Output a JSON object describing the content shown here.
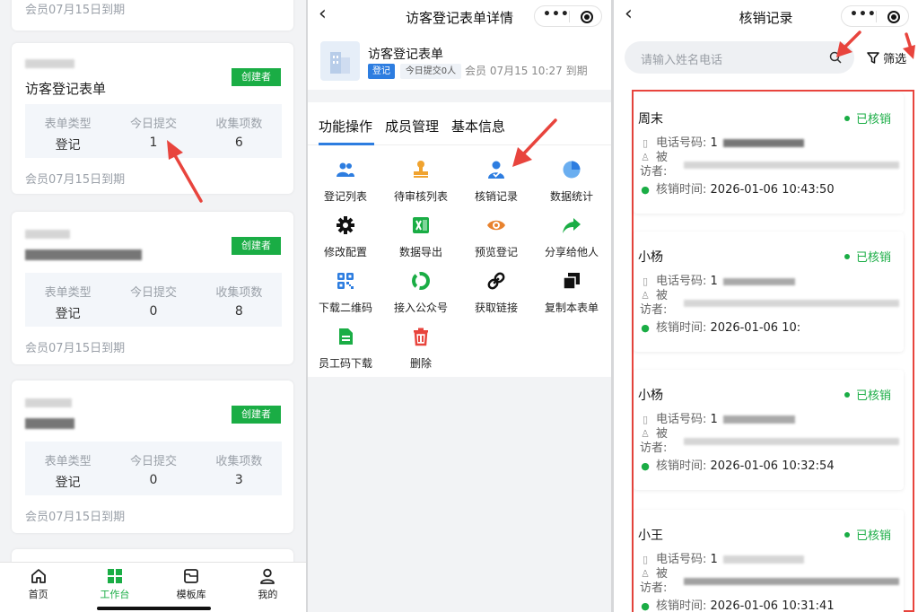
{
  "workbench": {
    "top_expire": "会员07月15日到期",
    "cards": [
      {
        "title": "访客登记表单",
        "badge": "创建者",
        "stat_labels": [
          "表单类型",
          "今日提交",
          "收集项数"
        ],
        "stat_values": [
          "登记",
          "1",
          "6"
        ],
        "expire": "会员07月15日到期"
      },
      {
        "title": "",
        "badge": "创建者",
        "stat_labels": [
          "表单类型",
          "今日提交",
          "收集项数"
        ],
        "stat_values": [
          "登记",
          "0",
          "8"
        ],
        "expire": "会员07月15日到期"
      },
      {
        "title": "",
        "badge": "创建者",
        "stat_labels": [
          "表单类型",
          "今日提交",
          "收集项数"
        ],
        "stat_values": [
          "登记",
          "0",
          "3"
        ],
        "expire": "会员07月15日到期"
      }
    ],
    "tabbar": [
      {
        "label": "首页",
        "icon": "home-icon"
      },
      {
        "label": "工作台",
        "icon": "grid-icon",
        "active": true
      },
      {
        "label": "模板库",
        "icon": "folder-icon"
      },
      {
        "label": "我的",
        "icon": "user-icon"
      }
    ]
  },
  "detail": {
    "title": "访客登记表单详情",
    "form_name": "访客登记表单",
    "tag_type": "登记",
    "tag_today": "今日提交0人",
    "member_time": "会员 07月15 10:27 到期",
    "tabs": [
      "功能操作",
      "成员管理",
      "基本信息"
    ],
    "functions": [
      {
        "label": "登记列表",
        "icon": "users-icon",
        "color": "#2d7de0"
      },
      {
        "label": "待审核列表",
        "icon": "stamp-icon",
        "color": "#f0a32f"
      },
      {
        "label": "核销记录",
        "icon": "user-check-icon",
        "color": "#2d7de0"
      },
      {
        "label": "数据统计",
        "icon": "pie-chart-icon",
        "color": "#3a8ee6"
      },
      {
        "label": "修改配置",
        "icon": "gear-icon",
        "color": "#111111"
      },
      {
        "label": "数据导出",
        "icon": "excel-icon",
        "color": "#1aad45"
      },
      {
        "label": "预览登记",
        "icon": "eye-icon",
        "color": "#e8822e"
      },
      {
        "label": "分享给他人",
        "icon": "share-icon",
        "color": "#1aad45"
      },
      {
        "label": "下载二维码",
        "icon": "qrcode-icon",
        "color": "#2d7de0"
      },
      {
        "label": "接入公众号",
        "icon": "loop-icon",
        "color": "#1aad45"
      },
      {
        "label": "获取链接",
        "icon": "link-icon",
        "color": "#111111"
      },
      {
        "label": "复制本表单",
        "icon": "copy-icon",
        "color": "#111111"
      },
      {
        "label": "员工码下载",
        "icon": "file-icon",
        "color": "#1aad45"
      },
      {
        "label": "删除",
        "icon": "trash-icon",
        "color": "#e8443d"
      }
    ]
  },
  "records": {
    "title": "核销记录",
    "search_placeholder": "请输入姓名电话",
    "filter_label": "筛选",
    "phone_label": "电话号码:",
    "visitee_label": "被访者:",
    "time_label": "核销时间:",
    "items": [
      {
        "name": "周末",
        "status": "已核销",
        "phone": "1",
        "time": "2026-01-06 10:43:50"
      },
      {
        "name": "小杨",
        "status": "已核销",
        "phone": "1",
        "time": "2026-01-06 10:"
      },
      {
        "name": "小杨",
        "status": "已核销",
        "phone": "1",
        "time": "2026-01-06 10:32:54"
      },
      {
        "name": "小王",
        "status": "已核销",
        "phone": "1",
        "time": "2026-01-06 10:31:41"
      }
    ]
  }
}
